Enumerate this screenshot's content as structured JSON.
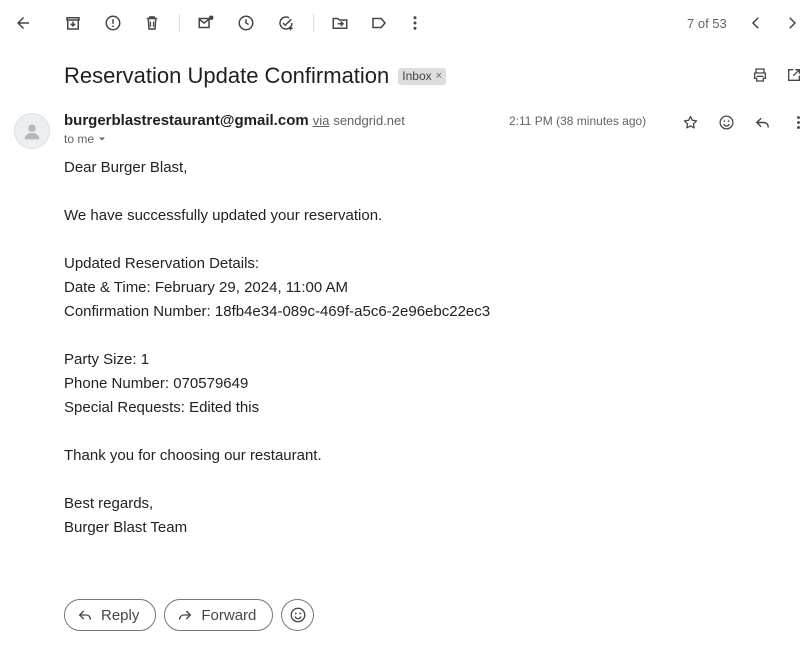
{
  "toolbar": {
    "pager": "7 of 53"
  },
  "email": {
    "subject": "Reservation Update Confirmation",
    "label": "Inbox",
    "label_remove": "×",
    "sender": "burgerblastrestaurant@gmail.com",
    "via": "via",
    "via_domain": "sendgrid.net",
    "recipient": "to me",
    "time": "2:11 PM (38 minutes ago)",
    "body_lines": [
      "Dear Burger Blast,",
      "",
      "We have successfully updated your reservation.",
      "",
      "Updated Reservation Details:",
      "Date & Time: February 29, 2024, 11:00 AM",
      "Confirmation Number: 18fb4e34-089c-469f-a5c6-2e96ebc22ec3",
      "",
      "Party Size: 1",
      "Phone Number: 070579649",
      "Special Requests: Edited this",
      "",
      "Thank you for choosing our restaurant.",
      "",
      "Best regards,",
      "Burger Blast Team"
    ]
  },
  "actions": {
    "reply": "Reply",
    "forward": "Forward"
  },
  "colors": {
    "icon": "#444746",
    "secondary_text": "#5f6368",
    "chip_bg": "#dddddd"
  }
}
